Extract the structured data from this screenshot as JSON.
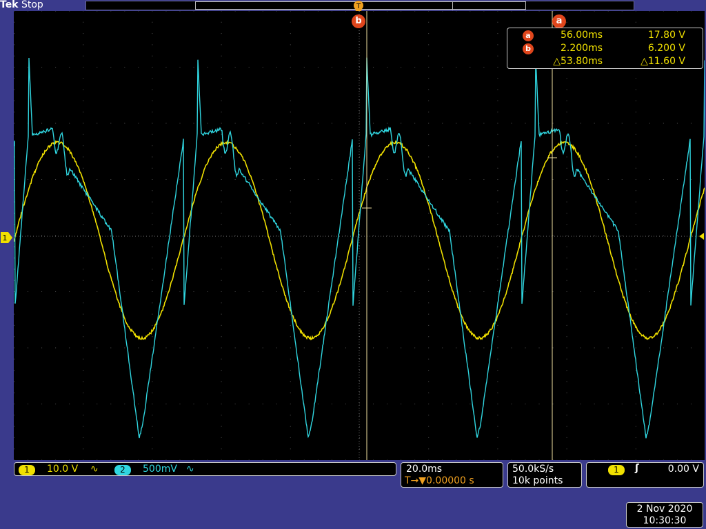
{
  "header": {
    "brand": "Tek",
    "status": "Stop"
  },
  "cursors": {
    "a_label": "a",
    "b_label": "b",
    "readout": {
      "a_time": "56.00ms",
      "a_volt": "17.80 V",
      "b_time": "2.200ms",
      "b_volt": "6.200 V",
      "delta_time": "△53.80ms",
      "delta_volt": "△11.60 V"
    }
  },
  "channels": {
    "ch1": {
      "label": "1",
      "scale": "10.0 V",
      "coupling": "∿",
      "color": "#f0e000"
    },
    "ch2": {
      "label": "2",
      "scale": "500mV",
      "coupling": "∿",
      "color": "#30d6e0"
    }
  },
  "timebase": {
    "scale": "20.0ms",
    "trigger_delay": "T→▼0.00000 s"
  },
  "acquisition": {
    "rate": "50.0kS/s",
    "record": "10k points"
  },
  "trigger": {
    "source": "1",
    "slope": "ʃ",
    "level": "0.00 V"
  },
  "datetime": {
    "date": "2 Nov 2020",
    "time": "10:30:30"
  }
}
